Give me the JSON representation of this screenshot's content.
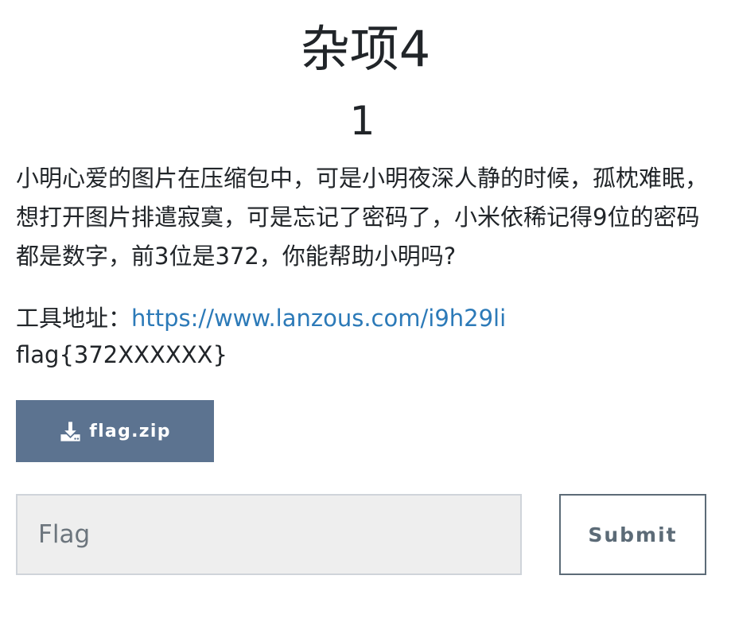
{
  "challenge": {
    "title": "杂项4",
    "value": "1",
    "description": "小明心爱的图片在压缩包中，可是小明夜深人静的时候，孤枕难眠，想打开图片排遣寂寞，可是忘记了密码了，小米依稀记得9位的密码都是数字，前3位是372，你能帮助小明吗?",
    "tool_label": "工具地址：",
    "tool_url": "https://www.lanzous.com/i9h29li",
    "flag_format": "flag{372XXXXXX}"
  },
  "download": {
    "label": "flag.zip",
    "icon": "download-icon"
  },
  "flag_form": {
    "placeholder": "Flag",
    "value": "",
    "submit_label": "Submit"
  }
}
